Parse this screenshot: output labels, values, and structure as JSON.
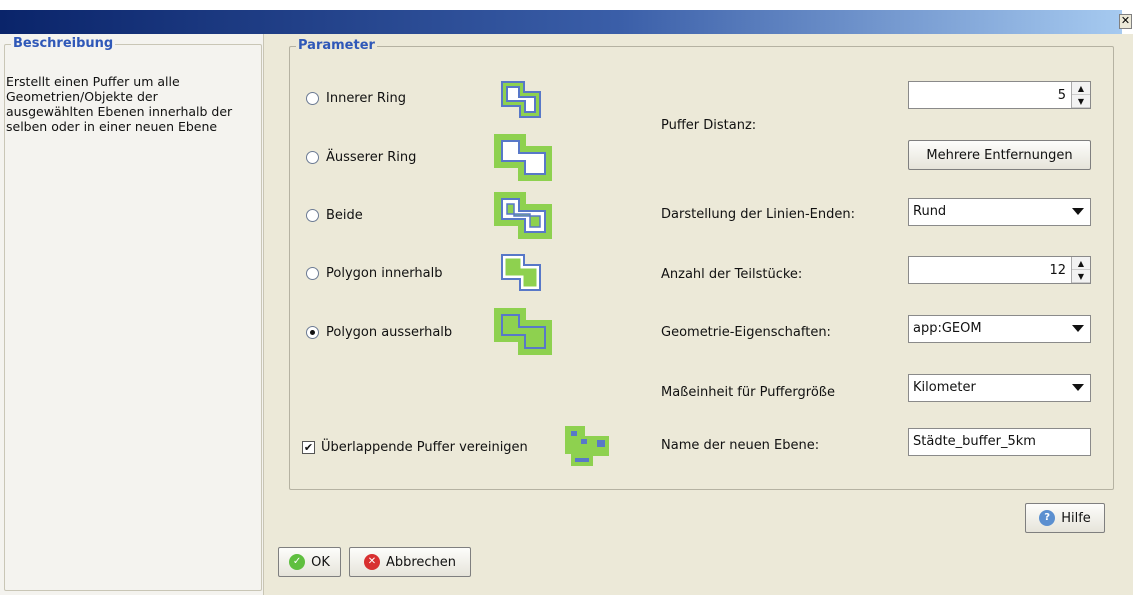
{
  "window": {
    "close_label": "✕"
  },
  "description": {
    "legend": "Beschreibung",
    "text": "Erstellt einen Puffer um alle Geometrien/Objekte der ausgewählten Ebenen innerhalb der selben oder in einer neuen Ebene"
  },
  "parameter": {
    "legend": "Parameter",
    "options": [
      {
        "label": "Innerer Ring",
        "selected": false,
        "icon": "inner-ring-icon"
      },
      {
        "label": "Äusserer Ring",
        "selected": false,
        "icon": "outer-ring-icon"
      },
      {
        "label": "Beide",
        "selected": false,
        "icon": "both-rings-icon"
      },
      {
        "label": "Polygon innerhalb",
        "selected": false,
        "icon": "polygon-inside-icon"
      },
      {
        "label": "Polygon ausserhalb",
        "selected": true,
        "icon": "polygon-outside-icon"
      }
    ],
    "merge_checkbox": {
      "label": "Überlappende Puffer vereinigen",
      "checked": true
    },
    "fields": {
      "buffer_distance_label": "Puffer Distanz:",
      "buffer_distance_value": "5",
      "multiple_distances_button": "Mehrere Entfernungen",
      "line_ends_label": "Darstellung der Linien-Enden:",
      "line_ends_value": "Rund",
      "segments_label": "Anzahl der Teilstücke:",
      "segments_value": "12",
      "geometry_label": "Geometrie-Eigenschaften:",
      "geometry_value": "app:GEOM",
      "unit_label": "Maßeinheit für Puffergröße",
      "unit_value": "Kilometer",
      "layer_name_label": "Name der neuen Ebene:",
      "layer_name_value": "Städte_buffer_5km"
    }
  },
  "buttons": {
    "help": "Hilfe",
    "ok": "OK",
    "cancel": "Abbrechen"
  },
  "colors": {
    "green": "#8ed14f",
    "blue": "#5878c8",
    "legend": "#2f58b8"
  }
}
